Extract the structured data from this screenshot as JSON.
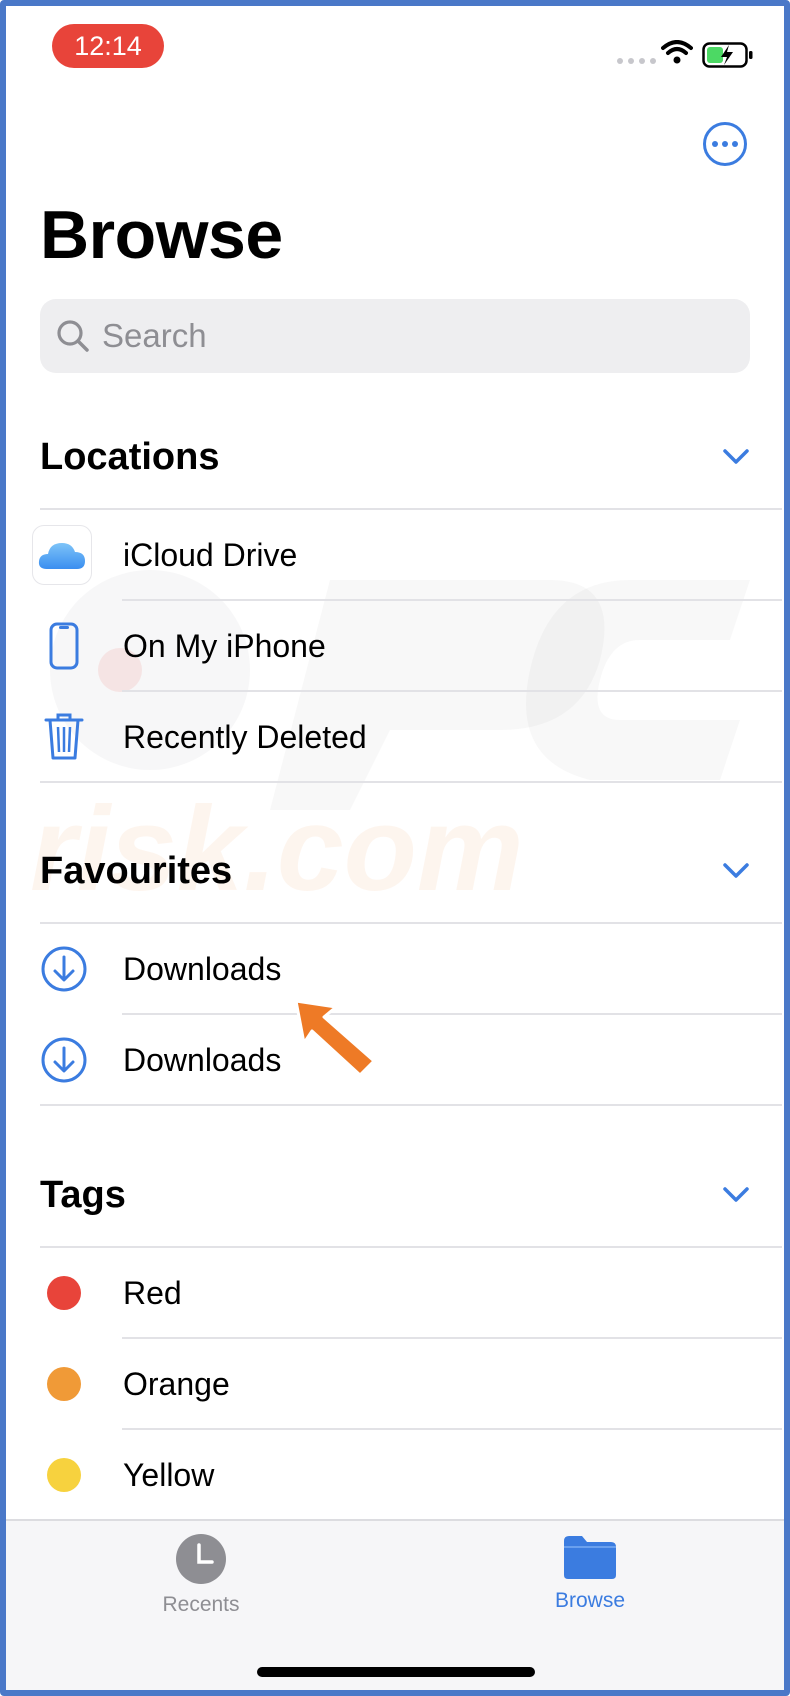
{
  "status_bar": {
    "time": "12:14"
  },
  "header": {
    "title": "Browse"
  },
  "search": {
    "placeholder": "Search"
  },
  "locations": {
    "title": "Locations",
    "items": [
      {
        "label": "iCloud Drive",
        "icon": "icloud-icon"
      },
      {
        "label": "On My iPhone",
        "icon": "iphone-icon"
      },
      {
        "label": "Recently Deleted",
        "icon": "trash-icon"
      }
    ]
  },
  "favourites": {
    "title": "Favourites",
    "items": [
      {
        "label": "Downloads",
        "icon": "download-icon"
      },
      {
        "label": "Downloads",
        "icon": "download-icon"
      }
    ]
  },
  "tags": {
    "title": "Tags",
    "items": [
      {
        "label": "Red",
        "color": "#e8443a"
      },
      {
        "label": "Orange",
        "color": "#f09a37"
      },
      {
        "label": "Yellow",
        "color": "#f7d23e"
      }
    ]
  },
  "tabbar": {
    "tabs": [
      {
        "label": "Recents",
        "active": false
      },
      {
        "label": "Browse",
        "active": true
      }
    ]
  },
  "colors": {
    "accent": "#3b7ce0",
    "inactive": "#8e8e93",
    "annotation_arrow": "#ee7a26"
  }
}
